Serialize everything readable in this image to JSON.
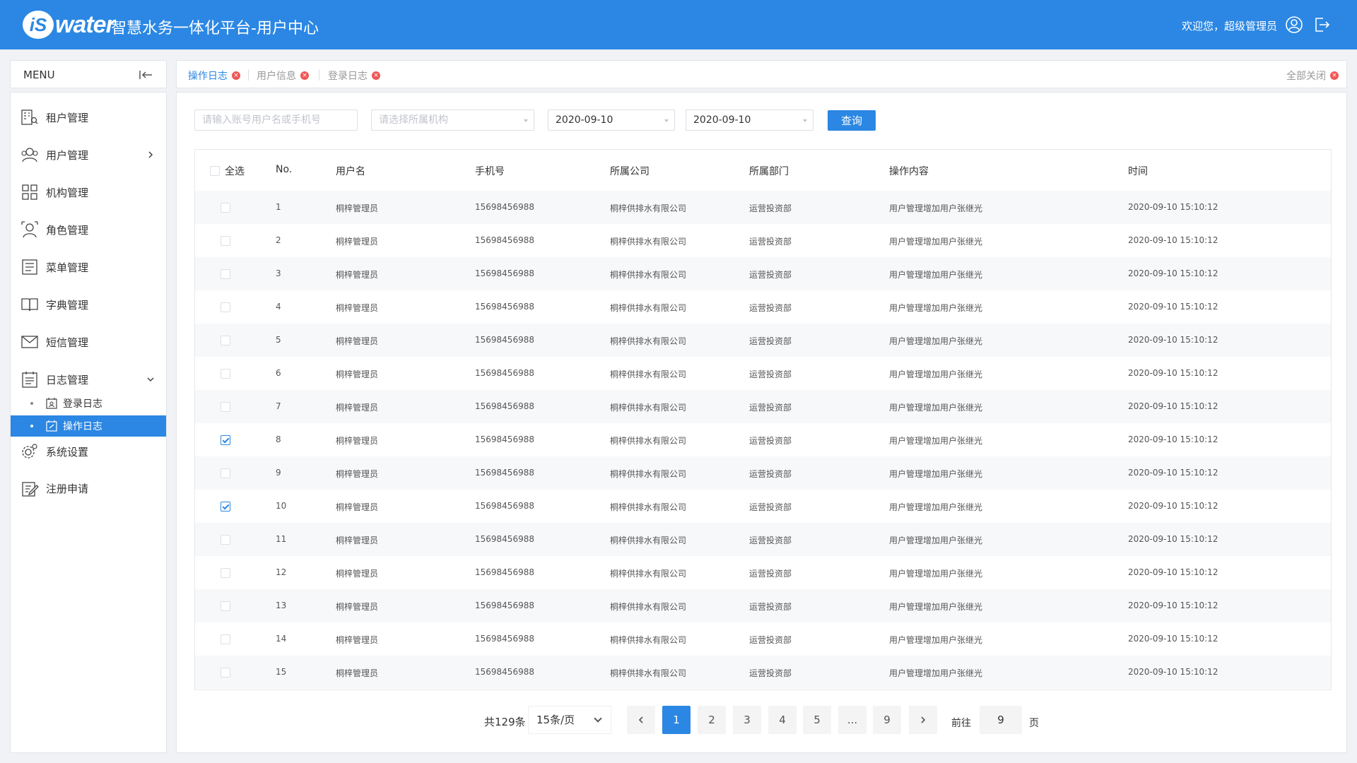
{
  "header": {
    "logo_is": "iS",
    "logo_water": "water",
    "title": "智慧水务一体化平台-用户中心",
    "welcome": "欢迎您，超级管理员"
  },
  "sidebar": {
    "menu_title": "MENU",
    "items": [
      {
        "label": "租户管理",
        "icon": "tenant-icon"
      },
      {
        "label": "用户管理",
        "icon": "users-icon"
      },
      {
        "label": "机构管理",
        "icon": "org-icon"
      },
      {
        "label": "角色管理",
        "icon": "role-icon"
      },
      {
        "label": "菜单管理",
        "icon": "menu-list-icon"
      },
      {
        "label": "字典管理",
        "icon": "book-icon"
      },
      {
        "label": "短信管理",
        "icon": "mail-icon"
      },
      {
        "label": "日志管理",
        "icon": "log-icon"
      },
      {
        "label": "系统设置",
        "icon": "settings-icon"
      },
      {
        "label": "注册申请",
        "icon": "register-icon"
      }
    ],
    "sub_items": [
      {
        "label": "登录日志"
      },
      {
        "label": "操作日志"
      }
    ]
  },
  "tabs": [
    {
      "label": "操作日志",
      "active": true
    },
    {
      "label": "用户信息",
      "active": false
    },
    {
      "label": "登录日志",
      "active": false
    }
  ],
  "close_all": "全部关闭",
  "filters": {
    "search_placeholder": "请输入账号用户名或手机号",
    "org_placeholder": "请选择所属机构",
    "date_start": "2020-09-10",
    "date_end": "2020-09-10",
    "query_label": "查询"
  },
  "table": {
    "select_all": "全选",
    "columns": [
      "No.",
      "用户名",
      "手机号",
      "所属公司",
      "所属部门",
      "操作内容",
      "时间"
    ],
    "rows": [
      {
        "no": "1",
        "user": "桐梓管理员",
        "phone": "15698456988",
        "company": "桐梓供排水有限公司",
        "dept": "运营投资部",
        "action": "用户管理增加用户张继光",
        "time": "2020-09-10 15:10:12",
        "checked": false
      },
      {
        "no": "2",
        "user": "桐梓管理员",
        "phone": "15698456988",
        "company": "桐梓供排水有限公司",
        "dept": "运营投资部",
        "action": "用户管理增加用户张继光",
        "time": "2020-09-10 15:10:12",
        "checked": false
      },
      {
        "no": "3",
        "user": "桐梓管理员",
        "phone": "15698456988",
        "company": "桐梓供排水有限公司",
        "dept": "运营投资部",
        "action": "用户管理增加用户张继光",
        "time": "2020-09-10 15:10:12",
        "checked": false
      },
      {
        "no": "4",
        "user": "桐梓管理员",
        "phone": "15698456988",
        "company": "桐梓供排水有限公司",
        "dept": "运营投资部",
        "action": "用户管理增加用户张继光",
        "time": "2020-09-10 15:10:12",
        "checked": false
      },
      {
        "no": "5",
        "user": "桐梓管理员",
        "phone": "15698456988",
        "company": "桐梓供排水有限公司",
        "dept": "运营投资部",
        "action": "用户管理增加用户张继光",
        "time": "2020-09-10 15:10:12",
        "checked": false
      },
      {
        "no": "6",
        "user": "桐梓管理员",
        "phone": "15698456988",
        "company": "桐梓供排水有限公司",
        "dept": "运营投资部",
        "action": "用户管理增加用户张继光",
        "time": "2020-09-10 15:10:12",
        "checked": false
      },
      {
        "no": "7",
        "user": "桐梓管理员",
        "phone": "15698456988",
        "company": "桐梓供排水有限公司",
        "dept": "运营投资部",
        "action": "用户管理增加用户张继光",
        "time": "2020-09-10 15:10:12",
        "checked": false
      },
      {
        "no": "8",
        "user": "桐梓管理员",
        "phone": "15698456988",
        "company": "桐梓供排水有限公司",
        "dept": "运营投资部",
        "action": "用户管理增加用户张继光",
        "time": "2020-09-10 15:10:12",
        "checked": true
      },
      {
        "no": "9",
        "user": "桐梓管理员",
        "phone": "15698456988",
        "company": "桐梓供排水有限公司",
        "dept": "运营投资部",
        "action": "用户管理增加用户张继光",
        "time": "2020-09-10 15:10:12",
        "checked": false
      },
      {
        "no": "10",
        "user": "桐梓管理员",
        "phone": "15698456988",
        "company": "桐梓供排水有限公司",
        "dept": "运营投资部",
        "action": "用户管理增加用户张继光",
        "time": "2020-09-10 15:10:12",
        "checked": true
      },
      {
        "no": "11",
        "user": "桐梓管理员",
        "phone": "15698456988",
        "company": "桐梓供排水有限公司",
        "dept": "运营投资部",
        "action": "用户管理增加用户张继光",
        "time": "2020-09-10 15:10:12",
        "checked": false
      },
      {
        "no": "12",
        "user": "桐梓管理员",
        "phone": "15698456988",
        "company": "桐梓供排水有限公司",
        "dept": "运营投资部",
        "action": "用户管理增加用户张继光",
        "time": "2020-09-10 15:10:12",
        "checked": false
      },
      {
        "no": "13",
        "user": "桐梓管理员",
        "phone": "15698456988",
        "company": "桐梓供排水有限公司",
        "dept": "运营投资部",
        "action": "用户管理增加用户张继光",
        "time": "2020-09-10 15:10:12",
        "checked": false
      },
      {
        "no": "14",
        "user": "桐梓管理员",
        "phone": "15698456988",
        "company": "桐梓供排水有限公司",
        "dept": "运营投资部",
        "action": "用户管理增加用户张继光",
        "time": "2020-09-10 15:10:12",
        "checked": false
      },
      {
        "no": "15",
        "user": "桐梓管理员",
        "phone": "15698456988",
        "company": "桐梓供排水有限公司",
        "dept": "运营投资部",
        "action": "用户管理增加用户张继光",
        "time": "2020-09-10 15:10:12",
        "checked": false
      }
    ]
  },
  "pagination": {
    "total": "共129条",
    "page_size": "15条/页",
    "pages": [
      "1",
      "2",
      "3",
      "4",
      "5",
      "...",
      "9"
    ],
    "current": "1",
    "goto_prefix": "前往",
    "goto_value": "9",
    "goto_suffix": "页"
  },
  "colors": {
    "primary": "#2b87e3",
    "tab_close": "#f05656"
  }
}
